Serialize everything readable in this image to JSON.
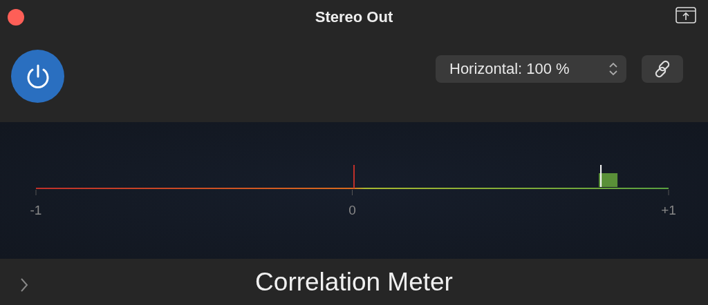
{
  "window": {
    "title": "Stereo Out"
  },
  "power": {
    "on": true
  },
  "view_select": {
    "value": "Horizontal: 100 %"
  },
  "meter": {
    "ticks": [
      "-1",
      "0",
      "+1"
    ],
    "level": 0.893
  },
  "footer": {
    "title": "Correlation Meter"
  }
}
